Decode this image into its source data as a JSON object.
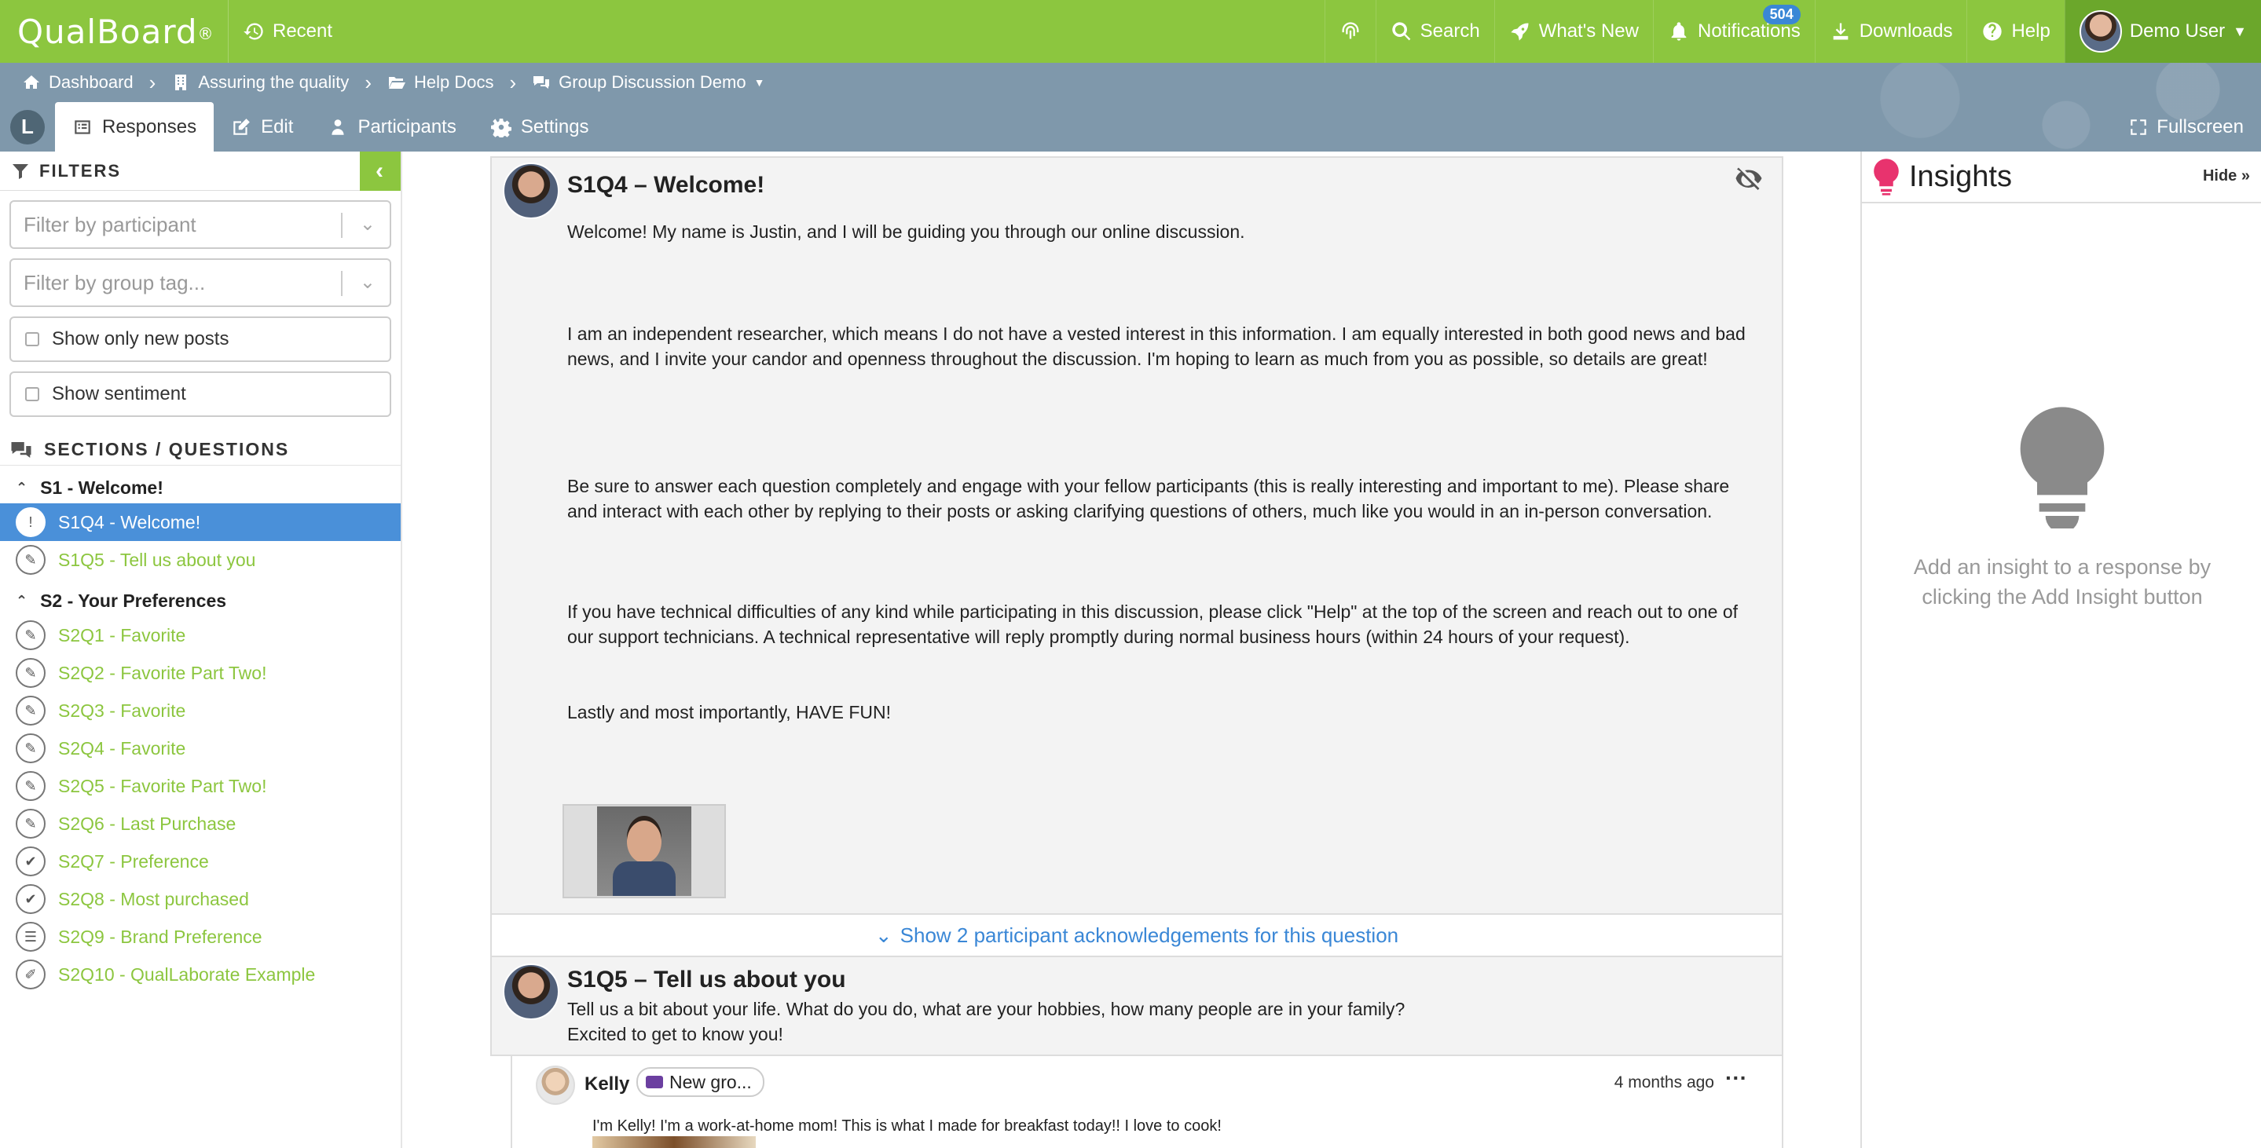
{
  "topbar": {
    "brand": "QualBoard",
    "brand_mark": "®",
    "recent": "Recent",
    "search": "Search",
    "whats_new": "What's New",
    "notifications": "Notifications",
    "notifications_count": "504",
    "downloads": "Downloads",
    "help": "Help",
    "user": "Demo User"
  },
  "breadcrumb": {
    "dashboard": "Dashboard",
    "project": "Assuring the quality",
    "folder": "Help Docs",
    "discussion": "Group Discussion Demo"
  },
  "tabs": {
    "home_glyph": "L",
    "responses": "Responses",
    "edit": "Edit",
    "participants": "Participants",
    "settings": "Settings",
    "fullscreen": "Fullscreen"
  },
  "sidebar": {
    "filters_title": "FILTERS",
    "filter_participant": "Filter by participant",
    "filter_group_tag": "Filter by group tag...",
    "show_new_posts": "Show only new posts",
    "show_sentiment": "Show sentiment",
    "sections_title": "SECTIONS / QUESTIONS",
    "sections": [
      {
        "label": "S1 - Welcome!",
        "items": [
          {
            "label": "S1Q4 - Welcome!",
            "icon": "alert-icon",
            "glyph": "!"
          },
          {
            "label": "S1Q5 - Tell us about you",
            "icon": "comment-icon",
            "glyph": "✎"
          }
        ]
      },
      {
        "label": "S2 - Your Preferences",
        "items": [
          {
            "label": "S2Q1 - Favorite",
            "icon": "comment-icon",
            "glyph": "✎"
          },
          {
            "label": "S2Q2 - Favorite Part Two!",
            "icon": "comment-icon",
            "glyph": "✎"
          },
          {
            "label": "S2Q3 - Favorite",
            "icon": "comment-icon",
            "glyph": "✎"
          },
          {
            "label": "S2Q4 - Favorite",
            "icon": "comment-icon",
            "glyph": "✎"
          },
          {
            "label": "S2Q5 - Favorite Part Two!",
            "icon": "comment-icon",
            "glyph": "✎"
          },
          {
            "label": "S2Q6 - Last Purchase",
            "icon": "comment-icon",
            "glyph": "✎"
          },
          {
            "label": "S2Q7 - Preference",
            "icon": "check-circle-icon",
            "glyph": "✔"
          },
          {
            "label": "S2Q8 - Most purchased",
            "icon": "check-circle-icon",
            "glyph": "✔"
          },
          {
            "label": "S2Q9 - Brand Preference",
            "icon": "list-icon",
            "glyph": "☰"
          },
          {
            "label": "S2Q10 - QualLaborate Example",
            "icon": "pencil-icon",
            "glyph": "✐"
          }
        ]
      }
    ]
  },
  "questions": {
    "q1": {
      "title": "S1Q4 – Welcome!",
      "p1": "Welcome! My name is Justin, and I will be guiding you through our online discussion.",
      "p2": "I am an independent researcher, which means I do not have a vested interest in this information. I am equally interested in both good news and bad news, and I invite your candor and openness throughout the discussion. I'm hoping to learn as much from you as possible, so details are great!",
      "p3": "Be sure to answer each question completely and engage with your fellow participants (this is really interesting and important to me). Please share and interact with each other by replying to their posts or asking clarifying questions of others, much like you would in an in-person conversation.",
      "p4": "If you have technical difficulties of any kind while participating in this discussion, please click \"Help\" at the top of the screen and reach out to one of our support technicians. A technical representative will reply promptly during normal business hours (within 24 hours of your request).",
      "p5": "Lastly and most importantly, HAVE FUN!"
    },
    "ack": "Show 2 participant acknowledgements for this question",
    "q2": {
      "title": "S1Q5 – Tell us about you",
      "p1": "Tell us a bit about your life. What do you do, what are your hobbies, how many people are in your family?",
      "p2": "Excited to get to know you!"
    },
    "response": {
      "name": "Kelly",
      "tag": "New gro...",
      "time": "4 months ago",
      "more": "···",
      "text": "I'm Kelly! I'm a work-at-home mom! This is what I made for breakfast today!! I love to cook!"
    }
  },
  "insights": {
    "title": "Insights",
    "hide": "Hide",
    "empty": "Add an insight to a response by clicking the Add Insight button"
  },
  "colors": {
    "brand_green": "#8cc63f",
    "band_gray": "#7f98ab",
    "active_blue": "#4a90d9",
    "link_blue": "#3a87d6",
    "insight_pink": "#e8336e"
  }
}
